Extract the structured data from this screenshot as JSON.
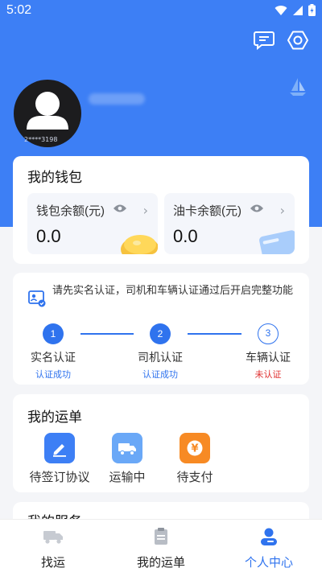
{
  "status_bar": {
    "time": "5:02"
  },
  "colors": {
    "primary": "#3d7ff5",
    "accent_blue": "#2f73ee",
    "danger": "#e02f2f",
    "muted": "#9aa0a8"
  },
  "header": {
    "icons": [
      "message-icon",
      "settings-icon"
    ],
    "avatar_sub": "2****3198"
  },
  "wallet": {
    "title": "我的钱包",
    "wallet_balance": {
      "label": "钱包余额(元)",
      "value": "0.0"
    },
    "fuel_balance": {
      "label": "油卡余额(元)",
      "value": "0.0"
    }
  },
  "verify": {
    "notice": "请先实名认证，司机和车辆认证通过后开启完整功能",
    "steps": [
      {
        "num": "1",
        "name": "实名认证",
        "status": "认证成功",
        "status_color": "#2f73ee"
      },
      {
        "num": "2",
        "name": "司机认证",
        "status": "认证成功",
        "status_color": "#2f73ee"
      },
      {
        "num": "3",
        "name": "车辆认证",
        "status": "未认证",
        "status_color": "#e02f2f"
      }
    ]
  },
  "orders": {
    "title": "我的运单",
    "items": [
      {
        "label": "待签订协议",
        "icon": "pen-icon",
        "color": "#3d7ff5"
      },
      {
        "label": "运输中",
        "icon": "truck-icon",
        "color": "#6aa8f7"
      },
      {
        "label": "待支付",
        "icon": "yen-icon",
        "color": "#f78a24"
      }
    ]
  },
  "services": {
    "title": "我的服务"
  },
  "tabbar": {
    "tabs": [
      {
        "label": "找运",
        "icon": "truck-icon",
        "active": false
      },
      {
        "label": "我的运单",
        "icon": "clipboard-icon",
        "active": false
      },
      {
        "label": "个人中心",
        "icon": "person-icon",
        "active": true
      }
    ]
  }
}
